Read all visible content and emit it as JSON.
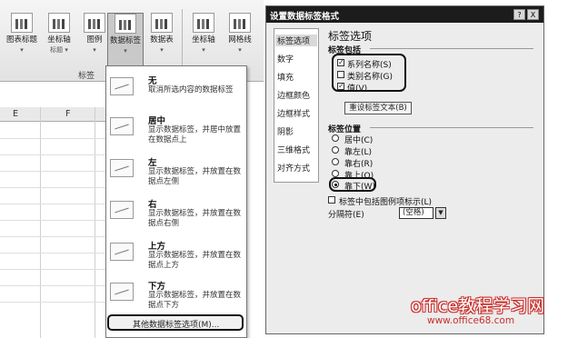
{
  "ribbon": {
    "buttons": [
      {
        "label": "图表标题",
        "sub": "▾"
      },
      {
        "label": "坐标轴",
        "sub": "标题 ▾"
      },
      {
        "label": "图例",
        "sub": "▾"
      },
      {
        "label": "数据标签",
        "sub": "▾"
      },
      {
        "label": "数据表",
        "sub": "▾"
      },
      {
        "label": "坐标轴",
        "sub": "▾"
      },
      {
        "label": "网格线",
        "sub": "▾"
      }
    ],
    "group_label": "标签"
  },
  "sheet": {
    "columns": [
      "E",
      "F"
    ]
  },
  "dropdown": {
    "items": [
      {
        "title": "无",
        "desc": "取消所选内容的数据标签"
      },
      {
        "title": "居中",
        "desc": "显示数据标签，并居中放置在数据点上"
      },
      {
        "title": "左",
        "desc": "显示数据标签，并放置在数据点左侧"
      },
      {
        "title": "右",
        "desc": "显示数据标签，并放置在数据点右侧"
      },
      {
        "title": "上方",
        "desc": "显示数据标签，并放置在数据点上方"
      },
      {
        "title": "下方",
        "desc": "显示数据标签，并放置在数据点下方"
      }
    ],
    "more": "其他数据标签选项(M)..."
  },
  "dialog": {
    "title": "设置数据标签格式",
    "title_buttons": [
      "?",
      "X"
    ],
    "categories": [
      "标签选项",
      "数字",
      "填充",
      "边框颜色",
      "边框样式",
      "阴影",
      "三维格式",
      "对齐方式"
    ],
    "section_title": "标签选项",
    "contains": {
      "heading": "标签包括",
      "options": [
        {
          "label": "系列名称(S)",
          "checked": true
        },
        {
          "label": "类别名称(G)",
          "checked": false
        },
        {
          "label": "值(V)",
          "checked": true
        }
      ],
      "reset_button": "重设标签文本(B)"
    },
    "position": {
      "heading": "标签位置",
      "options": [
        {
          "label": "居中(C)",
          "selected": false
        },
        {
          "label": "靠左(L)",
          "selected": false
        },
        {
          "label": "靠右(R)",
          "selected": false
        },
        {
          "label": "靠上(O)",
          "selected": false
        },
        {
          "label": "靠下(W)",
          "selected": true
        }
      ]
    },
    "legend_key": {
      "label": "标签中包括图例项标示(L)",
      "checked": false
    },
    "separator": {
      "label": "分隔符(E)",
      "value": "(空格)"
    }
  },
  "watermark": {
    "line1": "office教程学习网",
    "line2": "www.office68.com"
  },
  "colors": {
    "watermark": "#c9302c",
    "titlebar": "#1c1c1c"
  }
}
